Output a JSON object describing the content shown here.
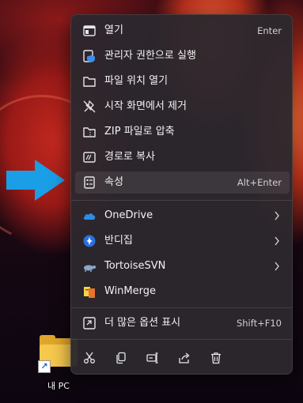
{
  "desktop": {
    "shortcut_label": "내 PC"
  },
  "menu": {
    "items": [
      {
        "label": "열기",
        "shortcut": "Enter"
      },
      {
        "label": "관리자 권한으로 실행"
      },
      {
        "label": "파일 위치 열기"
      },
      {
        "label": "시작 화면에서 제거"
      },
      {
        "label": "ZIP 파일로 압축"
      },
      {
        "label": "경로로 복사"
      },
      {
        "label": "속성",
        "shortcut": "Alt+Enter"
      },
      {
        "label": "OneDrive",
        "submenu": true
      },
      {
        "label": "반디집",
        "submenu": true
      },
      {
        "label": "TortoiseSVN",
        "submenu": true
      },
      {
        "label": "WinMerge"
      },
      {
        "label": "더 많은 옵션 표시",
        "shortcut": "Shift+F10"
      }
    ],
    "toolbar": [
      "cut-icon",
      "copy-icon",
      "rename-icon",
      "share-icon",
      "delete-icon"
    ]
  },
  "colors": {
    "accent": "#1a9ee6",
    "menu_bg": "#2c282e",
    "folder": "#f6c84c"
  }
}
